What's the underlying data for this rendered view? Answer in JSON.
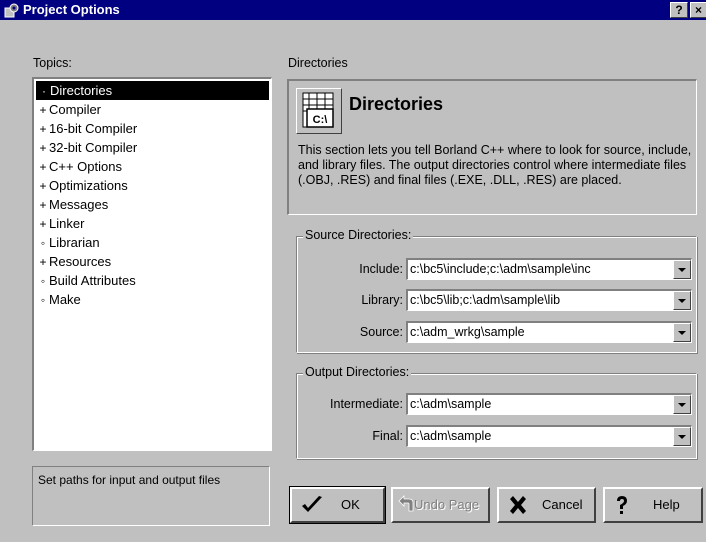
{
  "window": {
    "title": "Project Options",
    "help_button": "?",
    "close_button": "×"
  },
  "topics": {
    "label": "Topics:",
    "items": [
      {
        "label": "Directories",
        "glyph": "·",
        "selected": true
      },
      {
        "label": "Compiler",
        "glyph": "+"
      },
      {
        "label": "16-bit Compiler",
        "glyph": "+"
      },
      {
        "label": "32-bit Compiler",
        "glyph": "+"
      },
      {
        "label": "C++ Options",
        "glyph": "+"
      },
      {
        "label": "Optimizations",
        "glyph": "+"
      },
      {
        "label": "Messages",
        "glyph": "+"
      },
      {
        "label": "Linker",
        "glyph": "+"
      },
      {
        "label": "Librarian",
        "glyph": "◦"
      },
      {
        "label": "Resources",
        "glyph": "+"
      },
      {
        "label": "Build Attributes",
        "glyph": "◦"
      },
      {
        "label": "Make",
        "glyph": "◦"
      }
    ]
  },
  "status_text": "Set paths for input and output files",
  "section": {
    "label": "Directories",
    "heading": "Directories",
    "description": "This section lets you tell Borland C++ where to look for source, include, and library files.  The output directories control where intermediate files (.OBJ, .RES) and final files (.EXE, .DLL, .RES) are placed."
  },
  "source_dirs": {
    "title": "Source Directories:",
    "include_label": "Include:",
    "include_value": "c:\\bc5\\include;c:\\adm\\sample\\inc",
    "library_label": "Library:",
    "library_value": "c:\\bc5\\lib;c:\\adm\\sample\\lib",
    "source_label": "Source:",
    "source_value": "c:\\adm_wrkg\\sample"
  },
  "output_dirs": {
    "title": "Output Directories:",
    "intermediate_label": "Intermediate:",
    "intermediate_value": "c:\\adm\\sample",
    "final_label": "Final:",
    "final_value": "c:\\adm\\sample"
  },
  "buttons": {
    "ok": "OK",
    "undo": "Undo Page",
    "cancel": "Cancel",
    "help": "Help"
  },
  "colors": {
    "titlebar": "#000080",
    "face": "#c0c0c0",
    "selection": "#000000"
  }
}
